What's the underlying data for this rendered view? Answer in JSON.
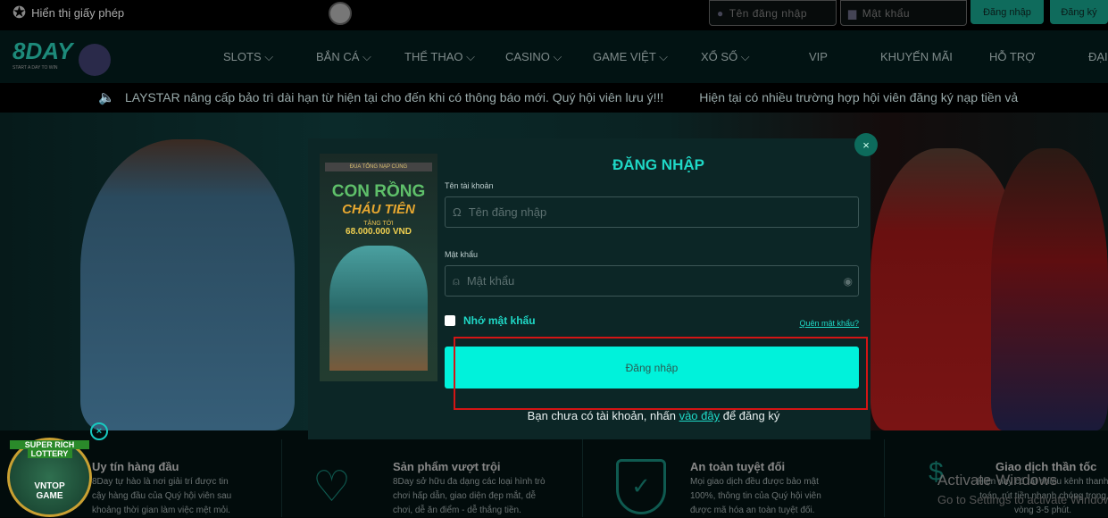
{
  "topbar": {
    "license_label": "Hiển thị giấy phép",
    "username_placeholder": "Tên đăng nhập",
    "password_placeholder": "Mật khẩu",
    "login_button": "Đăng nhập",
    "register_button": "Đăng ký"
  },
  "nav": {
    "logo_text": "8DAY",
    "logo_tagline": "START A DAY TO WIN",
    "items": [
      {
        "label": "SLOTS ⌵"
      },
      {
        "label": "BẮN CÁ ⌵"
      },
      {
        "label": "THỂ THAO ⌵"
      },
      {
        "label": "CASINO ⌵"
      },
      {
        "label": "GAME VIỆT ⌵"
      },
      {
        "label": "XỔ SỐ ⌵"
      },
      {
        "label": "VIP"
      },
      {
        "label": "KHUYẾN MÃI"
      },
      {
        "label": "HỖ TRỢ"
      },
      {
        "label": "ĐẠI"
      }
    ]
  },
  "ticker": {
    "message1": "LAYSTAR nâng cấp bảo trì dài hạn từ hiện tại cho đến khi có thông báo mới. Quý hội viên lưu ý!!!",
    "message2": "Hiện tại có nhiều trường hợp hội viên đăng ký nạp tiền vả"
  },
  "modal": {
    "title": "ĐĂNG NHẬP",
    "banner": {
      "top": "ĐUA TỔNG NẠP CÙNG",
      "line1": "CON RỒNG",
      "line2": "CHÁU TIÊN",
      "line3": "TẶNG TỚI",
      "amount": "68.000.000 VND"
    },
    "username_label": "Tên tài khoản",
    "username_placeholder": "Tên đăng nhập",
    "password_label": "Mật khẩu",
    "password_placeholder": "Mật khẩu",
    "remember_label": "Nhớ mật khẩu",
    "forgot_link": "Quên mật khẩu?",
    "login_button": "Đăng nhập",
    "register_prefix": "Bạn chưa có tài khoản, nhấn ",
    "register_link": "vào đây",
    "register_suffix": " để đăng ký",
    "close": "×"
  },
  "features": [
    {
      "title": "Uy tín hàng đầu",
      "text": "8Day tự hào là nơi giải trí được tin cậy hàng đầu của Quý hội viên sau khoảng thời gian làm việc mệt mỏi."
    },
    {
      "title": "Sản phẩm vượt trội",
      "text": "8Day sở hữu đa dạng các loại hình trò chơi hấp dẫn, giao diện đẹp mắt, dễ chơi, dễ ăn điểm - dễ thắng tiền."
    },
    {
      "title": "An toàn tuyệt đối",
      "text": "Mọi giao dịch đều được bảo mật 100%, thông tin của Quý hội viên được mã hóa an toàn tuyệt đối."
    },
    {
      "title": "Giao dịch thần tốc",
      "text": "Hiện nay có rất nhiều kênh thanh toán, rút tiền nhanh chóng trong vòng 3-5 phút."
    }
  ],
  "lottery": {
    "line1": "SUPER RICH",
    "line2": "LOTTERY",
    "line3": "VNTOP",
    "line4": "GAME",
    "close": "×"
  },
  "watermark": {
    "line1": "Activate Windows",
    "line2": "Go to Settings to activate Windows."
  },
  "colors": {
    "accent": "#00f2db",
    "title": "#1fd8c6",
    "highlight_box": "#d31515"
  }
}
